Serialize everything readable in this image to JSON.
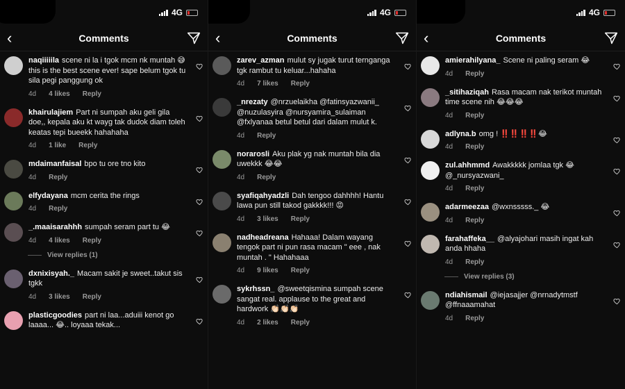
{
  "panels": [
    {
      "status": {
        "network": "4G"
      },
      "header": {
        "back_icon": "chevron-left-icon",
        "title": "Comments",
        "send_icon": "send-icon"
      },
      "comments": [
        {
          "user": "naqiiiiila",
          "text": "scene ni la i tgok mcm nk muntah 😅 this is the best scene ever! sape belum tgok tu sila pegi panggung ok",
          "time": "4d",
          "likes": "4 likes",
          "reply": "Reply",
          "avatar_color": "#cfcfcf"
        },
        {
          "user": "khairulajiem",
          "text": "Part ni sumpah aku geli gila doe,, kepala aku kt wayg tak dudok diam toleh keatas tepi bueekk hahahaha",
          "time": "4d",
          "likes": "1 like",
          "reply": "Reply",
          "avatar_color": "#8a2a2a"
        },
        {
          "user": "mdaimanfaisal",
          "text": "bpo tu ore tno kito",
          "time": "4d",
          "likes": "",
          "reply": "Reply",
          "avatar_color": "#4a4a42"
        },
        {
          "user": "elfydayana",
          "text": "mcm cerita the rings",
          "time": "4d",
          "likes": "",
          "reply": "Reply",
          "avatar_color": "#6b7a5a"
        },
        {
          "user": "_.maaisarahhh",
          "text": "sumpah seram part tu 😂",
          "time": "4d",
          "likes": "4 likes",
          "reply": "Reply",
          "avatar_color": "#5a4e52",
          "view_replies": "View replies (1)"
        },
        {
          "user": "dxnixisyah._",
          "text": "Macam sakit je sweet..takut sis tgkk",
          "time": "4d",
          "likes": "3 likes",
          "reply": "Reply",
          "avatar_color": "#6a6070"
        },
        {
          "user": "plasticgoodies",
          "text": "part ni laa...aduiii kenot go laaaa... 😂.. loyaaa tekak...",
          "time": "",
          "likes": "",
          "reply": "",
          "avatar_color": "#e8a0b0"
        }
      ]
    },
    {
      "status": {
        "network": "4G"
      },
      "header": {
        "back_icon": "chevron-left-icon",
        "title": "Comments",
        "send_icon": "send-icon"
      },
      "comments": [
        {
          "user": "zarev_azman",
          "text": "mulut sy jugak turut ternganga tgk rambut tu keluar...hahaha",
          "time": "4d",
          "likes": "7 likes",
          "reply": "Reply",
          "avatar_color": "#5a5a5a"
        },
        {
          "user": "_nrezaty",
          "text": "@nrzuelaikha @fatinsyazwanii_ @nuzulasyira @nursyamira_sulaiman @fxlyanaa betul betul dari dalam mulut k.",
          "time": "4d",
          "likes": "",
          "reply": "Reply",
          "avatar_color": "#3a3a3a"
        },
        {
          "user": "norarosli",
          "text": "Aku plak yg nak muntah bila dia uwekkk 😂😂",
          "time": "4d",
          "likes": "",
          "reply": "Reply",
          "avatar_color": "#7a8a6a"
        },
        {
          "user": "syafiqahyadzli",
          "text": "Dah tengoo dahhhh! Hantu lawa pun still takod gakkkk!!! 😡",
          "time": "4d",
          "likes": "3 likes",
          "reply": "Reply",
          "avatar_color": "#4a4a4a"
        },
        {
          "user": "nadheadreana",
          "text": "Hahaaa! Dalam wayang tengok part ni pun rasa macam \" eee , nak muntah . \" Hahahaaa",
          "time": "4d",
          "likes": "9 likes",
          "reply": "Reply",
          "avatar_color": "#8a8070"
        },
        {
          "user": "sykrhssn_",
          "text": "@sweetqismina sumpah scene sangat real. applause to the great and hardwork 👏🏻👏🏻👏🏻",
          "time": "4d",
          "likes": "2 likes",
          "reply": "Reply",
          "avatar_color": "#6a6a6a"
        }
      ]
    },
    {
      "status": {
        "network": "4G"
      },
      "header": {
        "back_icon": "chevron-left-icon",
        "title": "Comments",
        "send_icon": "send-icon"
      },
      "comments": [
        {
          "user": "amierahilyana_",
          "text": "Scene ni paling seram 😂",
          "time": "4d",
          "likes": "",
          "reply": "Reply",
          "avatar_color": "#e8e8e8"
        },
        {
          "user": "_sitihaziqah",
          "text": "Rasa macam nak terikot muntah time scene nih 😂😂😂",
          "time": "4d",
          "likes": "",
          "reply": "Reply",
          "avatar_color": "#8a7a80"
        },
        {
          "user": "adlyna.b",
          "text": "omg ! ‼️‼️‼️‼️😂",
          "time": "4d",
          "likes": "",
          "reply": "Reply",
          "avatar_color": "#d8d8d8"
        },
        {
          "user": "zul.ahhmmd",
          "text": "Awakkkkk jomlaa tgk 😂 @_nursyazwani_",
          "time": "4d",
          "likes": "",
          "reply": "Reply",
          "avatar_color": "#f0f0f0"
        },
        {
          "user": "adarmeezaa",
          "text": "@wxnsssss._ 😂",
          "time": "4d",
          "likes": "",
          "reply": "Reply",
          "avatar_color": "#9a9080"
        },
        {
          "user": "farahaffeka__",
          "text": "@alyajohari masih ingat kah anda hhaha",
          "time": "4d",
          "likes": "",
          "reply": "Reply",
          "avatar_color": "#c0b8b0",
          "view_replies": "View replies (3)"
        },
        {
          "user": "ndiahismail",
          "text": "@iejasajjer @nrnadytmstf @ffnaaamahat",
          "time": "4d",
          "likes": "",
          "reply": "Reply",
          "avatar_color": "#6a7a70"
        }
      ]
    }
  ]
}
